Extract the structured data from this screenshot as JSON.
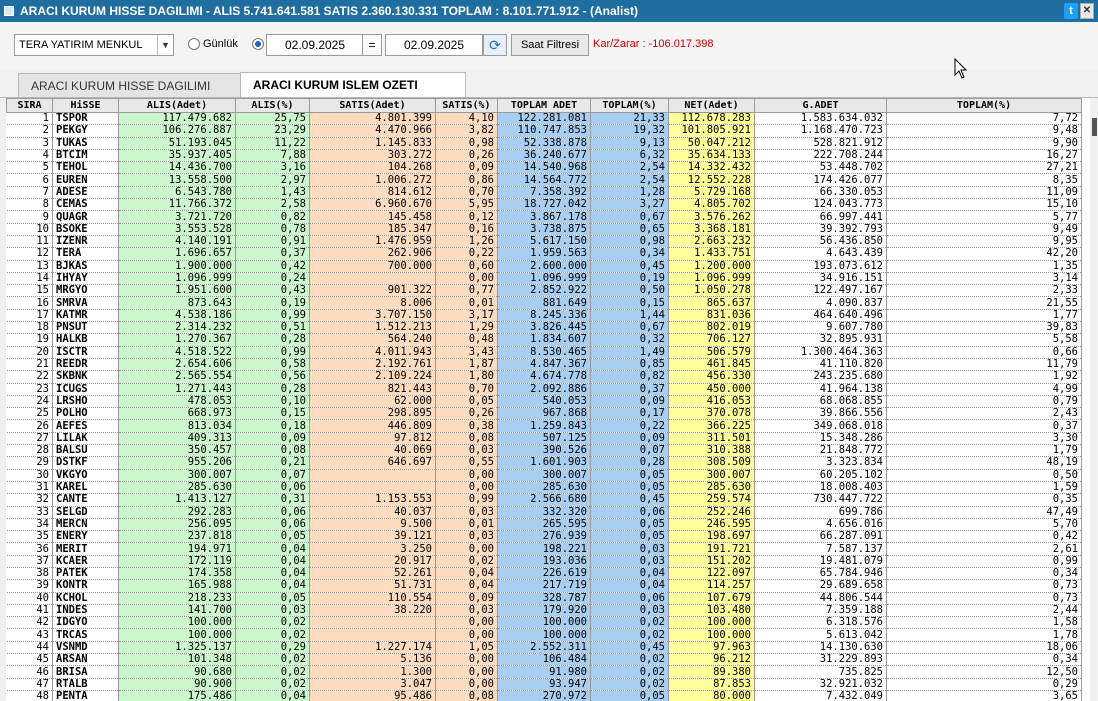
{
  "window": {
    "title": "ARACI KURUM HISSE DAGILIMI - ALIS 5.741.641.581  SATIS 2.360.130.331  TOPLAM : 8.101.771.912 - (Analist)",
    "twitter_icon": "twitter-icon",
    "close_icon": "close-icon"
  },
  "filters": {
    "broker": "TERA YATIRIM MENKUL",
    "radio_daily": "Günlük",
    "date_from": "02.09.2025",
    "equals": "=",
    "date_to": "02.09.2025",
    "filter_button": "Saat Filtresi",
    "profit_loss": "Kar/Zarar : -106.017.398"
  },
  "tabs": [
    {
      "label": "ARACI KURUM HISSE DAGILIMI",
      "active": false
    },
    {
      "label": "ARACI KURUM ISLEM OZETI",
      "active": true
    }
  ],
  "table": {
    "columns": [
      "SIRA",
      "HiSSE",
      "ALIS(Adet)",
      "ALIS(%)",
      "SATIS(Adet)",
      "SATIS(%)",
      "TOPLAM ADET",
      "TOPLAM(%)",
      "NET(Adet)",
      "G.ADET",
      "TOPLAM(%)"
    ],
    "rows": [
      [
        "1",
        "TSPOR",
        "117.479.682",
        "25,75",
        "4.801.399",
        "4,10",
        "122.281.081",
        "21,33",
        "112.678.283",
        "1.583.634.032",
        "7,72"
      ],
      [
        "2",
        "PEKGY",
        "106.276.887",
        "23,29",
        "4.470.966",
        "3,82",
        "110.747.853",
        "19,32",
        "101.805.921",
        "1.168.470.723",
        "9,48"
      ],
      [
        "3",
        "TUKAS",
        "51.193.045",
        "11,22",
        "1.145.833",
        "0,98",
        "52.338.878",
        "9,13",
        "50.047.212",
        "528.821.912",
        "9,90"
      ],
      [
        "4",
        "BTCIM",
        "35.937.405",
        "7,88",
        "303.272",
        "0,26",
        "36.240.677",
        "6,32",
        "35.634.133",
        "222.708.244",
        "16,27"
      ],
      [
        "5",
        "TEHOL",
        "14.436.700",
        "3,16",
        "104.268",
        "0,09",
        "14.540.968",
        "2,54",
        "14.332.432",
        "53.448.702",
        "27,21"
      ],
      [
        "6",
        "EUREN",
        "13.558.500",
        "2,97",
        "1.006.272",
        "0,86",
        "14.564.772",
        "2,54",
        "12.552.228",
        "174.426.077",
        "8,35"
      ],
      [
        "7",
        "ADESE",
        "6.543.780",
        "1,43",
        "814.612",
        "0,70",
        "7.358.392",
        "1,28",
        "5.729.168",
        "66.330.053",
        "11,09"
      ],
      [
        "8",
        "CEMAS",
        "11.766.372",
        "2,58",
        "6.960.670",
        "5,95",
        "18.727.042",
        "3,27",
        "4.805.702",
        "124.043.773",
        "15,10"
      ],
      [
        "9",
        "QUAGR",
        "3.721.720",
        "0,82",
        "145.458",
        "0,12",
        "3.867.178",
        "0,67",
        "3.576.262",
        "66.997.441",
        "5,77"
      ],
      [
        "10",
        "BSOKE",
        "3.553.528",
        "0,78",
        "185.347",
        "0,16",
        "3.738.875",
        "0,65",
        "3.368.181",
        "39.392.793",
        "9,49"
      ],
      [
        "11",
        "IZENR",
        "4.140.191",
        "0,91",
        "1.476.959",
        "1,26",
        "5.617.150",
        "0,98",
        "2.663.232",
        "56.436.850",
        "9,95"
      ],
      [
        "12",
        "TERA",
        "1.696.657",
        "0,37",
        "262.906",
        "0,22",
        "1.959.563",
        "0,34",
        "1.433.751",
        "4.643.439",
        "42,20"
      ],
      [
        "13",
        "BJKAS",
        "1.900.000",
        "0,42",
        "700.000",
        "0,60",
        "2.600.000",
        "0,45",
        "1.200.000",
        "193.073.612",
        "1,35"
      ],
      [
        "14",
        "IHYAY",
        "1.096.999",
        "0,24",
        "",
        "0,00",
        "1.096.999",
        "0,19",
        "1.096.999",
        "34.916.151",
        "3,14"
      ],
      [
        "15",
        "MRGYO",
        "1.951.600",
        "0,43",
        "901.322",
        "0,77",
        "2.852.922",
        "0,50",
        "1.050.278",
        "122.497.167",
        "2,33"
      ],
      [
        "16",
        "SMRVA",
        "873.643",
        "0,19",
        "8.006",
        "0,01",
        "881.649",
        "0,15",
        "865.637",
        "4.090.837",
        "21,55"
      ],
      [
        "17",
        "KATMR",
        "4.538.186",
        "0,99",
        "3.707.150",
        "3,17",
        "8.245.336",
        "1,44",
        "831.036",
        "464.640.496",
        "1,77"
      ],
      [
        "18",
        "PNSUT",
        "2.314.232",
        "0,51",
        "1.512.213",
        "1,29",
        "3.826.445",
        "0,67",
        "802.019",
        "9.607.780",
        "39,83"
      ],
      [
        "19",
        "HALKB",
        "1.270.367",
        "0,28",
        "564.240",
        "0,48",
        "1.834.607",
        "0,32",
        "706.127",
        "32.895.931",
        "5,58"
      ],
      [
        "20",
        "ISCTR",
        "4.518.522",
        "0,99",
        "4.011.943",
        "3,43",
        "8.530.465",
        "1,49",
        "506.579",
        "1.300.464.363",
        "0,66"
      ],
      [
        "21",
        "REEDR",
        "2.654.606",
        "0,58",
        "2.192.761",
        "1,87",
        "4.847.367",
        "0,85",
        "461.845",
        "41.110.820",
        "11,79"
      ],
      [
        "22",
        "SKBNK",
        "2.565.554",
        "0,56",
        "2.109.224",
        "1,80",
        "4.674.778",
        "0,82",
        "456.330",
        "243.235.680",
        "1,92"
      ],
      [
        "23",
        "ICUGS",
        "1.271.443",
        "0,28",
        "821.443",
        "0,70",
        "2.092.886",
        "0,37",
        "450.000",
        "41.964.138",
        "4,99"
      ],
      [
        "24",
        "LRSHO",
        "478.053",
        "0,10",
        "62.000",
        "0,05",
        "540.053",
        "0,09",
        "416.053",
        "68.068.855",
        "0,79"
      ],
      [
        "25",
        "POLHO",
        "668.973",
        "0,15",
        "298.895",
        "0,26",
        "967.868",
        "0,17",
        "370.078",
        "39.866.556",
        "2,43"
      ],
      [
        "26",
        "AEFES",
        "813.034",
        "0,18",
        "446.809",
        "0,38",
        "1.259.843",
        "0,22",
        "366.225",
        "349.068.018",
        "0,37"
      ],
      [
        "27",
        "LILAK",
        "409.313",
        "0,09",
        "97.812",
        "0,08",
        "507.125",
        "0,09",
        "311.501",
        "15.348.286",
        "3,30"
      ],
      [
        "28",
        "BALSU",
        "350.457",
        "0,08",
        "40.069",
        "0,03",
        "390.526",
        "0,07",
        "310.388",
        "21.848.772",
        "1,79"
      ],
      [
        "29",
        "DSTKF",
        "955.206",
        "0,21",
        "646.697",
        "0,55",
        "1.601.903",
        "0,28",
        "308.509",
        "3.323.834",
        "48,19"
      ],
      [
        "30",
        "VKGYO",
        "300.007",
        "0,07",
        "",
        "0,00",
        "300.007",
        "0,05",
        "300.007",
        "60.205.102",
        "0,50"
      ],
      [
        "31",
        "KAREL",
        "285.630",
        "0,06",
        "",
        "0,00",
        "285.630",
        "0,05",
        "285.630",
        "18.008.403",
        "1,59"
      ],
      [
        "32",
        "CANTE",
        "1.413.127",
        "0,31",
        "1.153.553",
        "0,99",
        "2.566.680",
        "0,45",
        "259.574",
        "730.447.722",
        "0,35"
      ],
      [
        "33",
        "SELGD",
        "292.283",
        "0,06",
        "40.037",
        "0,03",
        "332.320",
        "0,06",
        "252.246",
        "699.786",
        "47,49"
      ],
      [
        "34",
        "MERCN",
        "256.095",
        "0,06",
        "9.500",
        "0,01",
        "265.595",
        "0,05",
        "246.595",
        "4.656.016",
        "5,70"
      ],
      [
        "35",
        "ENERY",
        "237.818",
        "0,05",
        "39.121",
        "0,03",
        "276.939",
        "0,05",
        "198.697",
        "66.287.091",
        "0,42"
      ],
      [
        "36",
        "MERIT",
        "194.971",
        "0,04",
        "3.250",
        "0,00",
        "198.221",
        "0,03",
        "191.721",
        "7.587.137",
        "2,61"
      ],
      [
        "37",
        "KCAER",
        "172.119",
        "0,04",
        "20.917",
        "0,02",
        "193.036",
        "0,03",
        "151.202",
        "19.481.079",
        "0,99"
      ],
      [
        "38",
        "PATEK",
        "174.358",
        "0,04",
        "52.261",
        "0,04",
        "226.619",
        "0,04",
        "122.097",
        "65.784.946",
        "0,34"
      ],
      [
        "39",
        "KONTR",
        "165.988",
        "0,04",
        "51.731",
        "0,04",
        "217.719",
        "0,04",
        "114.257",
        "29.689.658",
        "0,73"
      ],
      [
        "40",
        "KCHOL",
        "218.233",
        "0,05",
        "110.554",
        "0,09",
        "328.787",
        "0,06",
        "107.679",
        "44.806.544",
        "0,73"
      ],
      [
        "41",
        "INDES",
        "141.700",
        "0,03",
        "38.220",
        "0,03",
        "179.920",
        "0,03",
        "103.480",
        "7.359.188",
        "2,44"
      ],
      [
        "42",
        "IDGYO",
        "100.000",
        "0,02",
        "",
        "0,00",
        "100.000",
        "0,02",
        "100.000",
        "6.318.576",
        "1,58"
      ],
      [
        "43",
        "TRCAS",
        "100.000",
        "0,02",
        "",
        "0,00",
        "100.000",
        "0,02",
        "100.000",
        "5.613.042",
        "1,78"
      ],
      [
        "44",
        "VSNMD",
        "1.325.137",
        "0,29",
        "1.227.174",
        "1,05",
        "2.552.311",
        "0,45",
        "97.963",
        "14.130.630",
        "18,06"
      ],
      [
        "45",
        "ARSAN",
        "101.348",
        "0,02",
        "5.136",
        "0,00",
        "106.484",
        "0,02",
        "96.212",
        "31.229.893",
        "0,34"
      ],
      [
        "46",
        "BRISA",
        "90.680",
        "0,02",
        "1.300",
        "0,00",
        "91.980",
        "0,02",
        "89.380",
        "735.825",
        "12,50"
      ],
      [
        "47",
        "RTALB",
        "90.900",
        "0,02",
        "3.047",
        "0,00",
        "93.947",
        "0,02",
        "87.853",
        "32.921.032",
        "0,29"
      ],
      [
        "48",
        "PENTA",
        "175.486",
        "0,04",
        "95.486",
        "0,08",
        "270.972",
        "0,05",
        "80.000",
        "7.432.049",
        "3,65"
      ],
      [
        "49",
        "EGEGY",
        "161.178",
        "0,04",
        "86.453",
        "0,07",
        "247.631",
        "0,04",
        "74.725",
        "2.799.954",
        "8,84"
      ]
    ]
  }
}
